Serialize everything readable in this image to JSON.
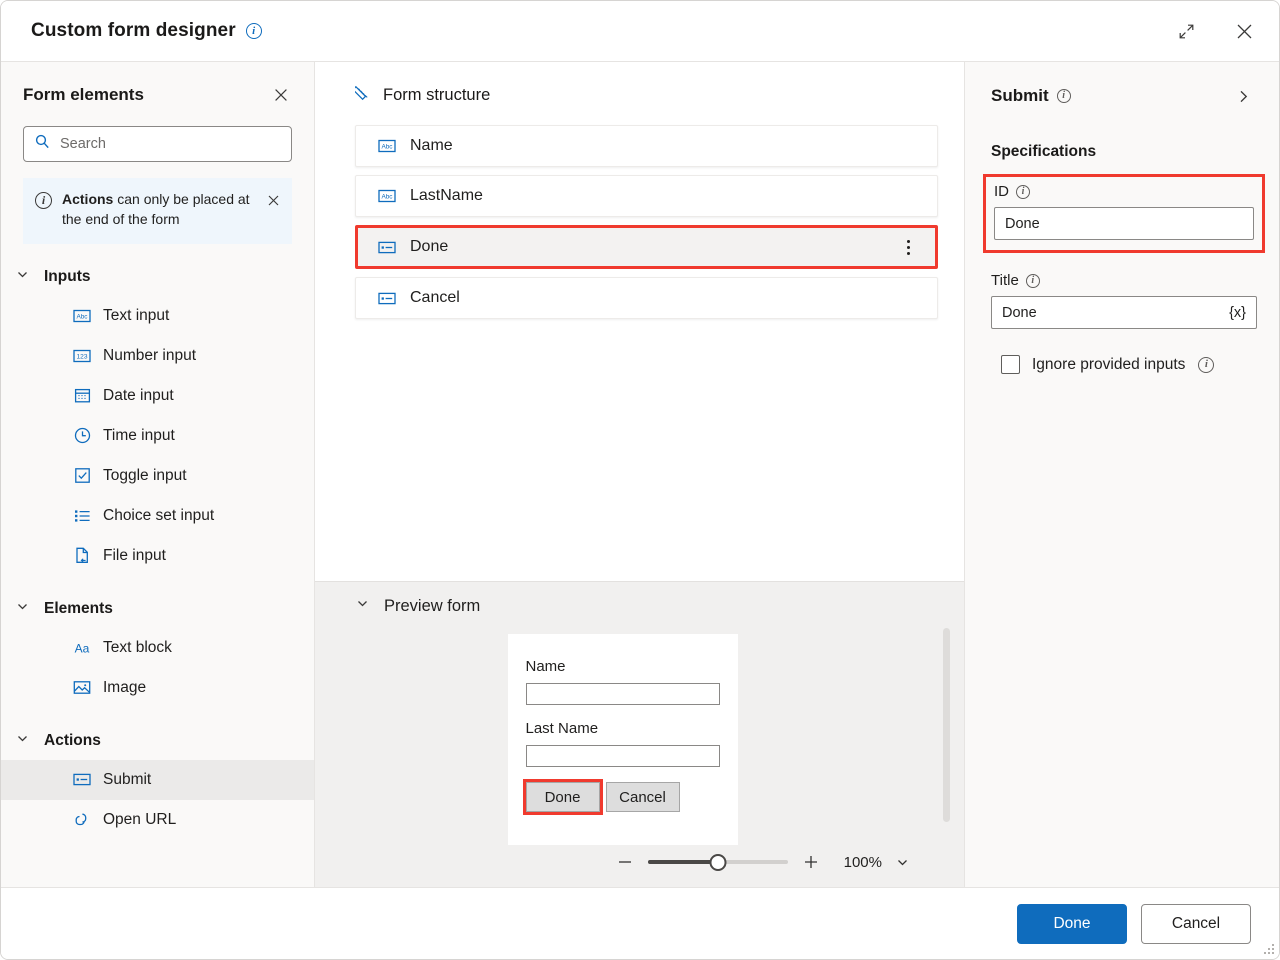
{
  "window": {
    "title": "Custom form designer",
    "title_info_icon": "info-icon",
    "expand_label": "Expand",
    "close_label": "Close"
  },
  "sidebar": {
    "title": "Form elements",
    "close_label": "Close",
    "search": {
      "placeholder": "Search",
      "value": ""
    },
    "notice": {
      "emphasis": "Actions",
      "rest": " can only be placed at the end of the form",
      "close_label": "Dismiss"
    },
    "groups": [
      {
        "label": "Inputs",
        "expanded": true,
        "items": [
          {
            "label": "Text input",
            "icon": "abc-text-icon"
          },
          {
            "label": "Number input",
            "icon": "number-123-icon"
          },
          {
            "label": "Date input",
            "icon": "calendar-icon"
          },
          {
            "label": "Time input",
            "icon": "clock-icon"
          },
          {
            "label": "Toggle input",
            "icon": "checkbox-icon"
          },
          {
            "label": "Choice set input",
            "icon": "list-icon"
          },
          {
            "label": "File input",
            "icon": "file-icon"
          }
        ]
      },
      {
        "label": "Elements",
        "expanded": true,
        "items": [
          {
            "label": "Text block",
            "icon": "aa-text-icon"
          },
          {
            "label": "Image",
            "icon": "image-icon"
          }
        ]
      },
      {
        "label": "Actions",
        "expanded": true,
        "items": [
          {
            "label": "Submit",
            "icon": "submit-button-icon",
            "selected": true
          },
          {
            "label": "Open URL",
            "icon": "link-icon"
          }
        ]
      }
    ]
  },
  "structure": {
    "title": "Form structure",
    "title_icon": "ruler-design-icon",
    "nodes": [
      {
        "label": "Name",
        "icon": "abc-text-icon",
        "highlighted": false
      },
      {
        "label": "LastName",
        "icon": "abc-text-icon",
        "highlighted": false
      },
      {
        "label": "Done",
        "icon": "submit-button-icon",
        "highlighted": true,
        "has_more_menu": true
      },
      {
        "label": "Cancel",
        "icon": "submit-button-icon",
        "highlighted": false
      }
    ]
  },
  "preview": {
    "title": "Preview form",
    "expanded": true,
    "card": {
      "fields": [
        {
          "label": "Name",
          "value": ""
        },
        {
          "label": "Last Name",
          "value": ""
        }
      ],
      "buttons": [
        {
          "label": "Done",
          "marked": true
        },
        {
          "label": "Cancel",
          "marked": false
        }
      ]
    },
    "zoom": {
      "decrease_label": "Zoom out",
      "increase_label": "Zoom in",
      "value": "100%",
      "slider_position_percent": 50,
      "caret_label": "Zoom options"
    }
  },
  "properties": {
    "title": "Submit",
    "title_info_icon": "info-icon",
    "collapse_label": "Collapse",
    "section_title": "Specifications",
    "id_field": {
      "label": "ID",
      "value": "Done",
      "info_icon": "info-icon",
      "highlighted": true
    },
    "title_field": {
      "label": "Title",
      "value": "Done",
      "info_icon": "info-icon",
      "token_button": "{x}"
    },
    "ignore_inputs": {
      "label": "Ignore provided inputs",
      "checked": false,
      "info_icon": "info-icon"
    }
  },
  "footer": {
    "primary": "Done",
    "secondary": "Cancel"
  },
  "colors": {
    "accent": "#0f6cbd",
    "highlight_marker": "#f03a2e",
    "panel_bg": "#faf9f8",
    "preview_bg": "#f1f0ef"
  }
}
